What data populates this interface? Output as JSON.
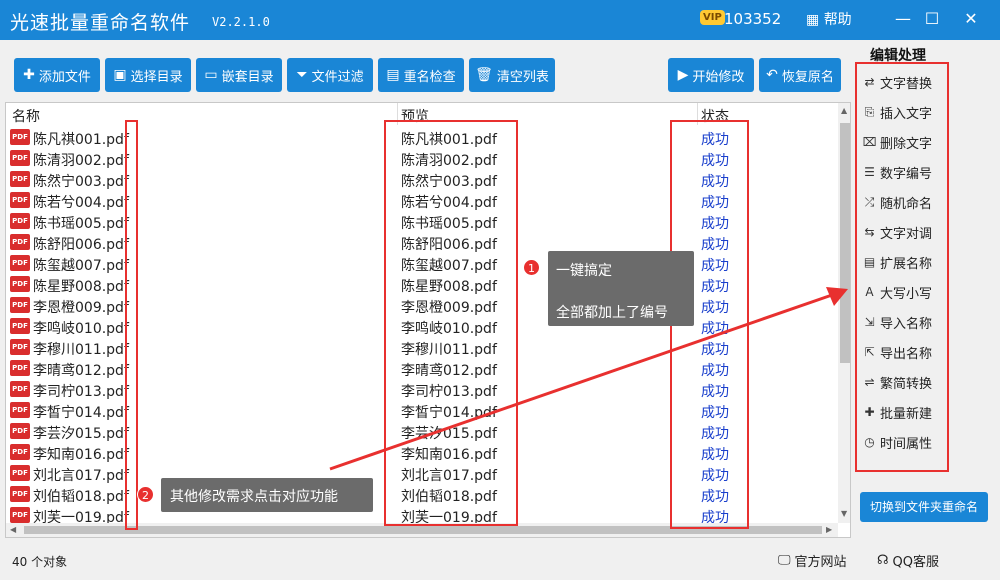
{
  "titlebar": {
    "title": "光速批量重命名软件",
    "version": "V2.2.1.0",
    "vip": "VIP",
    "user_id": "103352",
    "help": "帮助"
  },
  "toolbar": {
    "add_file": "添加文件",
    "select_dir": "选择目录",
    "nested_dir": "嵌套目录",
    "file_filter": "文件过滤",
    "dup_check": "重名检查",
    "clear_list": "清空列表",
    "start_modify": "开始修改",
    "restore_name": "恢复原名"
  },
  "table": {
    "columns": {
      "name": "名称",
      "preview": "预览",
      "status": "状态"
    },
    "rows": [
      {
        "name": "陈凡祺001.pdf",
        "preview": "陈凡祺001.pdf",
        "status": "成功"
      },
      {
        "name": "陈清羽002.pdf",
        "preview": "陈清羽002.pdf",
        "status": "成功"
      },
      {
        "name": "陈然宁003.pdf",
        "preview": "陈然宁003.pdf",
        "status": "成功"
      },
      {
        "name": "陈若兮004.pdf",
        "preview": "陈若兮004.pdf",
        "status": "成功"
      },
      {
        "name": "陈书瑶005.pdf",
        "preview": "陈书瑶005.pdf",
        "status": "成功"
      },
      {
        "name": "陈舒阳006.pdf",
        "preview": "陈舒阳006.pdf",
        "status": "成功"
      },
      {
        "name": "陈玺越007.pdf",
        "preview": "陈玺越007.pdf",
        "status": "成功"
      },
      {
        "name": "陈星野008.pdf",
        "preview": "陈星野008.pdf",
        "status": "成功"
      },
      {
        "name": "李恩橙009.pdf",
        "preview": "李恩橙009.pdf",
        "status": "成功"
      },
      {
        "name": "李鸣岐010.pdf",
        "preview": "李鸣岐010.pdf",
        "status": "成功"
      },
      {
        "name": "李穆川011.pdf",
        "preview": "李穆川011.pdf",
        "status": "成功"
      },
      {
        "name": "李晴鸢012.pdf",
        "preview": "李晴鸢012.pdf",
        "status": "成功"
      },
      {
        "name": "李司柠013.pdf",
        "preview": "李司柠013.pdf",
        "status": "成功"
      },
      {
        "name": "李皙宁014.pdf",
        "preview": "李皙宁014.pdf",
        "status": "成功"
      },
      {
        "name": "李芸汐015.pdf",
        "preview": "李芸汐015.pdf",
        "status": "成功"
      },
      {
        "name": "李知南016.pdf",
        "preview": "李知南016.pdf",
        "status": "成功"
      },
      {
        "name": "刘北言017.pdf",
        "preview": "刘北言017.pdf",
        "status": "成功"
      },
      {
        "name": "刘伯韬018.pdf",
        "preview": "刘伯韬018.pdf",
        "status": "成功"
      },
      {
        "name": "刘芙一019.pdf",
        "preview": "刘芙一019.pdf",
        "status": "成功"
      }
    ]
  },
  "callouts": {
    "c1_num": "1",
    "c1_line1": "一键搞定",
    "c1_line2": "全部都加上了编号",
    "c2_num": "2",
    "c2_text": "其他修改需求点击对应功能"
  },
  "sidebar": {
    "title": "编辑处理",
    "items": [
      {
        "label": "文字替换",
        "icon": "⇄"
      },
      {
        "label": "插入文字",
        "icon": "⎘"
      },
      {
        "label": "删除文字",
        "icon": "⌧"
      },
      {
        "label": "数字编号",
        "icon": "☰"
      },
      {
        "label": "随机命名",
        "icon": "⤮"
      },
      {
        "label": "文字对调",
        "icon": "⇆"
      },
      {
        "label": "扩展名称",
        "icon": "▤"
      },
      {
        "label": "大写小写",
        "icon": "A"
      },
      {
        "label": "导入名称",
        "icon": "⇲"
      },
      {
        "label": "导出名称",
        "icon": "⇱"
      },
      {
        "label": "繁简转换",
        "icon": "⇌"
      },
      {
        "label": "批量新建",
        "icon": "✚"
      },
      {
        "label": "时间属性",
        "icon": "◷"
      }
    ],
    "switch_button": "切换到文件夹重命名"
  },
  "statusbar": {
    "count": "40 个对象",
    "website": "官方网站",
    "qq": "QQ客服"
  },
  "colors": {
    "primary": "#1a86d6",
    "annotation_red": "#e8302f",
    "status_blue": "#1a3fcc"
  }
}
